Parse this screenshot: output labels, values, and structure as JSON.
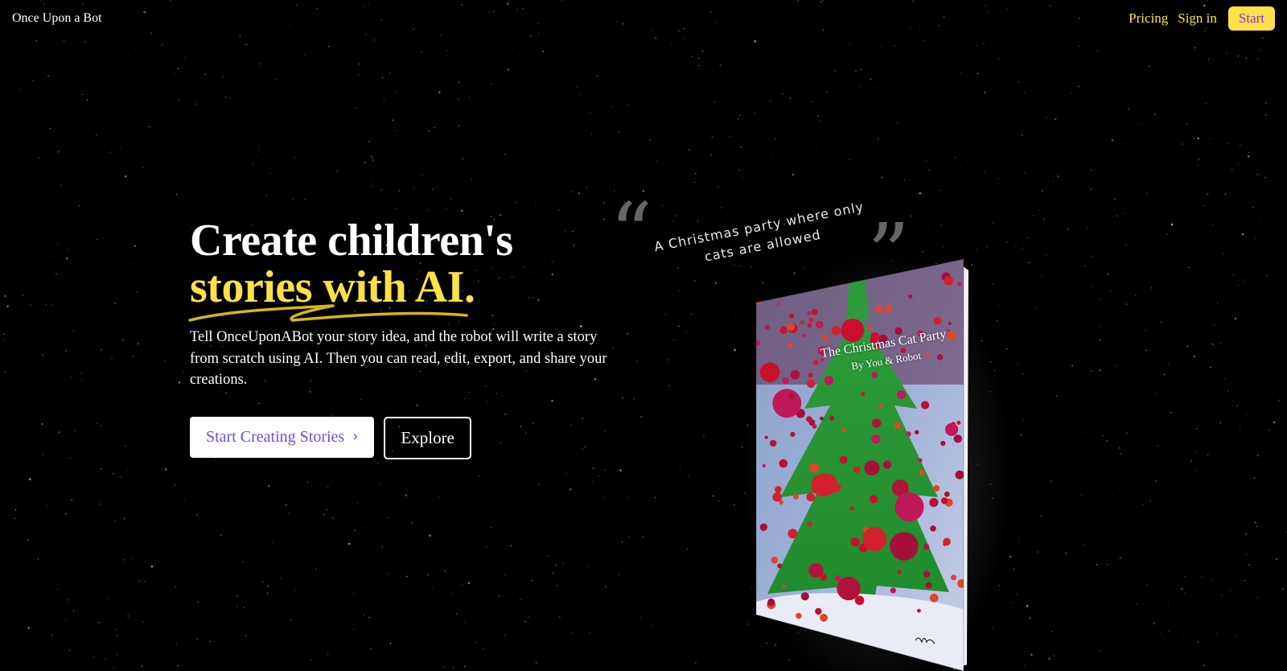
{
  "header": {
    "brand": "Once Upon a Bot",
    "nav": {
      "pricing": "Pricing",
      "sign_in": "Sign in",
      "start": "Start"
    }
  },
  "hero": {
    "title_line1": "Create children's",
    "title_line2": "stories with AI.",
    "description": "Tell OnceUponABot your story idea, and the robot will write a story from scratch using AI. Then you can read, edit, export, and share your creations.",
    "primary_cta": "Start Creating Stories",
    "secondary_cta": "Explore"
  },
  "example": {
    "prompt": "A Christmas party where only cats are allowed",
    "book": {
      "title": "The Christmas Cat Party",
      "byline": "By You & Robot"
    }
  },
  "colors": {
    "background": "#000000",
    "accent_yellow": "#fde047",
    "primary_text": "#6d4fcf"
  }
}
